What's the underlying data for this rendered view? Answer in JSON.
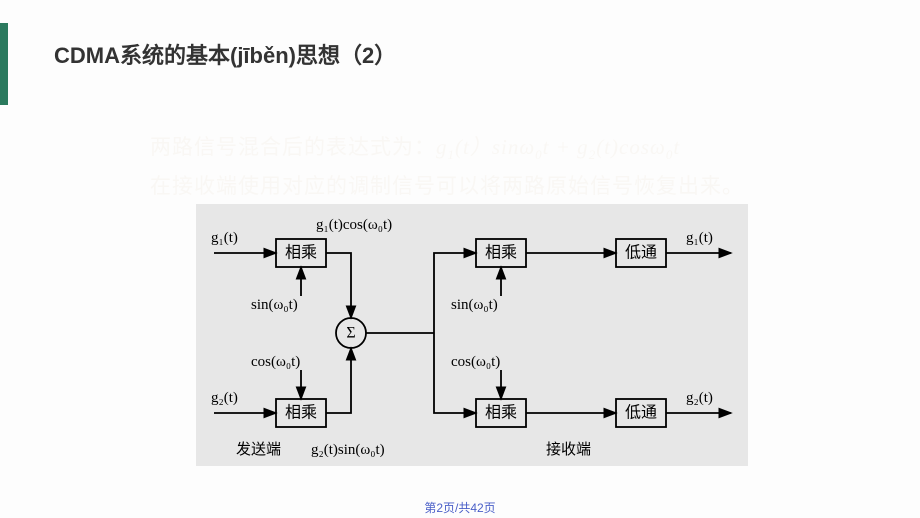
{
  "accent_color": "#2b7a5e",
  "title": "CDMA系统的基本(jīběn)思想（2）",
  "text": {
    "line1_pre": "两路信号混合后的表达式为：",
    "line1_formula_g1": "g",
    "line1_formula_sub1": "1",
    "line1_formula_t1": "(t）sin",
    "line1_formula_w1": "ω",
    "line1_formula_sub0a": "0",
    "line1_formula_tplus": "t + g",
    "line1_formula_sub2": "2",
    "line1_formula_t2": "(t)cos",
    "line1_formula_w2": "ω",
    "line1_formula_sub0b": "0",
    "line1_formula_tend": "t",
    "line2": "在接收端使用对应的调制信号可以将两路原始信号恢复出来。"
  },
  "diagram": {
    "g1_in": "g₁(t)",
    "g2_in": "g₂(t)",
    "g1_out": "g₁(t)",
    "g2_out": "g₂(t)",
    "mult": "相乘",
    "lpf": "低通",
    "sum": "Σ",
    "sin": "sin(ω₀t)",
    "cos": "cos(ω₀t)",
    "top_mix": "g₁(t)cos(ω₀t)",
    "bottom_mix": "g₂(t)sin(ω₀t)",
    "tx_label": "发送端",
    "rx_label": "接收端"
  },
  "footer": "第2页/共42页"
}
